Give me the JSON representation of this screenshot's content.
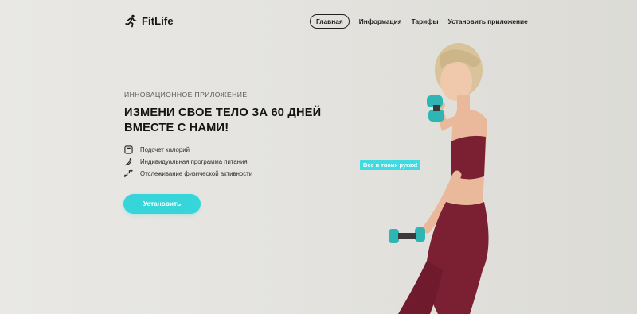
{
  "colors": {
    "accent": "#35d5d9",
    "background": "#e6e5e1",
    "text": "#161616"
  },
  "header": {
    "logo_text": "FitLife",
    "logo_icon": "runner-icon",
    "nav": [
      {
        "label": "Главная",
        "active": true
      },
      {
        "label": "Информация",
        "active": false
      },
      {
        "label": "Тарифы",
        "active": false
      },
      {
        "label": "Установить приложение",
        "active": false
      }
    ]
  },
  "hero": {
    "eyebrow": "ИННОВАЦИОННОЕ ПРИЛОЖЕНИЕ",
    "headline_line1": "ИЗМЕНИ СВОЕ ТЕЛО ЗА 60 ДНЕЙ",
    "headline_line2": "ВМЕСТЕ С НАМИ!",
    "features": [
      {
        "icon": "scale-icon",
        "text": "Подсчет калорий"
      },
      {
        "icon": "banana-icon",
        "text": "Индивидуальная программа питания"
      },
      {
        "icon": "growth-stairs-icon",
        "text": "Отслеживание физической активности"
      }
    ],
    "cta_label": "Установить",
    "badge": "Все в твоих руках!"
  }
}
